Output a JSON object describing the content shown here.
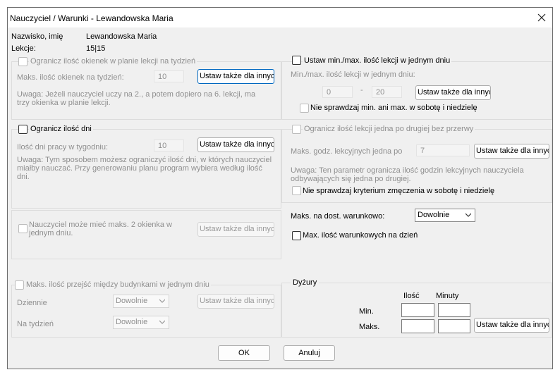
{
  "window": {
    "title": "Nauczyciel / Warunki - Lewandowska Maria"
  },
  "info": {
    "name_label": "Nazwisko, imię",
    "name_value": "Lewandowska Maria",
    "lessons_label": "Lekcje:",
    "lessons_value": "15|15"
  },
  "gaps": {
    "checkbox_label": "Ogranicz ilość okienek w planie lekcji na tydzień",
    "max_label": "Maks. ilość okienek na tydzień:",
    "max_value": "10",
    "set_button": "Ustaw także dla innych",
    "note": "Uwaga: Jeżeli nauczyciel uczy na 2., a potem dopiero na 6. lekcji, ma trzy okienka w planie lekcji."
  },
  "minmax": {
    "checkbox_label": "Ustaw min./max. ilość lekcji w jednym dniu",
    "label": "Min./max. ilość lekcji w jednym dniu:",
    "min_value": "0",
    "dash": "-",
    "max_value": "20",
    "set_button": "Ustaw także dla innych",
    "weekend_label": "Nie sprawdzaj min. ani max. w sobotę i niedzielę"
  },
  "days": {
    "checkbox_label": "Ogranicz ilość dni",
    "label": "Ilość dni pracy w tygodniu:",
    "value": "10",
    "set_button": "Ustaw także dla innych",
    "note": "Uwaga: Tym sposobem możesz ograniczyć ilość dni, w których nauczyciel miałby nauczać. Przy generowaniu planu program wybiera według ilość dni."
  },
  "consecutive": {
    "checkbox_label": "Ogranicz ilość lekcji jedna po drugiej bez przerwy",
    "label": "Maks. godz. lekcyjnych jedna po",
    "value": "7",
    "set_button": "Ustaw także dla innych",
    "note": "Uwaga: Ten parametr ogranicza ilość godzin lekcyjnych nauczyciela odbywających się jedna po drugiej.",
    "fatigue_label": "Nie sprawdzaj kryterium zmęczenia w sobotę i niedzielę"
  },
  "two_gaps": {
    "checkbox_label": "Nauczyciel może mieć maks. 2 okienka w jednym dniu.",
    "set_button": "Ustaw także dla innych"
  },
  "conditional": {
    "label": "Maks. na dost. warunkowo:",
    "select_value": "Dowolnie",
    "checkbox_label": "Max. ilość warunkowych na dzień"
  },
  "buildings": {
    "checkbox_label": "Maks. ilość przejść między budynkami w jednym dniu",
    "daily_label": "Dziennie",
    "daily_value": "Dowolnie",
    "weekly_label": "Na tydzień",
    "weekly_value": "Dowolnie",
    "set_button": "Ustaw także dla innych"
  },
  "duty": {
    "title": "Dyżury",
    "col_count": "Ilość",
    "col_minutes": "Minuty",
    "row_min": "Min.",
    "row_max": "Maks.",
    "set_button": "Ustaw także dla innych"
  },
  "footer": {
    "ok": "OK",
    "cancel": "Anuluj"
  }
}
